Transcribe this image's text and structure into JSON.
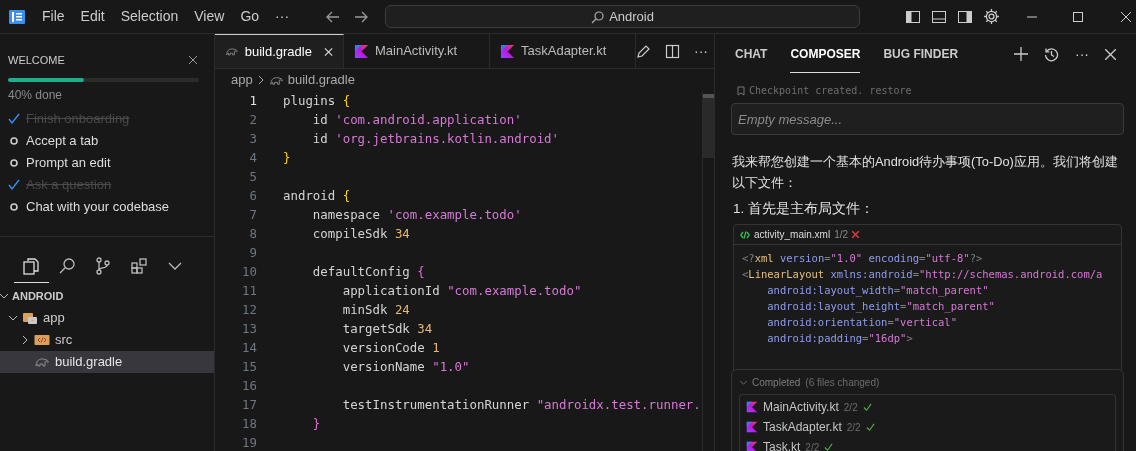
{
  "menu": [
    "File",
    "Edit",
    "Selection",
    "View",
    "Go",
    "···"
  ],
  "search": {
    "value": "Android"
  },
  "welcome": {
    "title": "WELCOME",
    "level": 0.4,
    "progress_text": "40% done",
    "items": [
      {
        "label": "Finish onboarding",
        "done": true
      },
      {
        "label": "Accept a tab",
        "done": false
      },
      {
        "label": "Prompt an edit",
        "done": false
      },
      {
        "label": "Ask a question",
        "done": true
      },
      {
        "label": "Chat with your codebase",
        "done": false
      }
    ]
  },
  "explorer": {
    "root": "ANDROID",
    "tree": [
      {
        "label": "app",
        "kind": "module",
        "expanded": true,
        "selected": false,
        "children": [
          {
            "label": "src",
            "kind": "folder",
            "expanded": false,
            "selected": false
          },
          {
            "label": "build.gradle",
            "kind": "gradle",
            "selected": true
          }
        ]
      }
    ]
  },
  "editor_tabs": [
    {
      "label": "build.gradle",
      "kind": "gradle",
      "selected": true
    },
    {
      "label": "MainActivity.kt",
      "kind": "kotlin",
      "selected": false
    },
    {
      "label": "TaskAdapter.kt",
      "kind": "kotlin",
      "selected": false
    }
  ],
  "breadcrumb": [
    "app",
    "build.gradle"
  ],
  "code": [
    {
      "number": "1",
      "current": true,
      "tokens": [
        {
          "kind": "plain",
          "text": "plugins "
        },
        {
          "kind": "brace1",
          "text": "{"
        }
      ]
    },
    {
      "number": "2",
      "current": false,
      "tokens": [
        {
          "kind": "plain",
          "text": "    id "
        },
        {
          "kind": "string",
          "text": "'com.android.application'"
        }
      ]
    },
    {
      "number": "3",
      "current": false,
      "tokens": [
        {
          "kind": "plain",
          "text": "    id "
        },
        {
          "kind": "string",
          "text": "'org.jetbrains.kotlin.android'"
        }
      ]
    },
    {
      "number": "4",
      "current": false,
      "tokens": [
        {
          "kind": "brace1",
          "text": "}"
        }
      ]
    },
    {
      "number": "5",
      "current": false
    },
    {
      "number": "6",
      "current": false,
      "tokens": [
        {
          "kind": "plain",
          "text": "android "
        },
        {
          "kind": "brace1",
          "text": "{"
        }
      ]
    },
    {
      "number": "7",
      "current": false,
      "tokens": [
        {
          "kind": "plain",
          "text": "    namespace "
        },
        {
          "kind": "string",
          "text": "'com.example.todo'"
        }
      ]
    },
    {
      "number": "8",
      "current": false,
      "tokens": [
        {
          "kind": "plain",
          "text": "    compileSdk "
        },
        {
          "kind": "number",
          "text": "34"
        }
      ]
    },
    {
      "number": "9",
      "current": false
    },
    {
      "number": "10",
      "current": false,
      "tokens": [
        {
          "kind": "plain",
          "text": "    defaultConfig "
        },
        {
          "kind": "brace2",
          "text": "{"
        }
      ]
    },
    {
      "number": "11",
      "current": false,
      "tokens": [
        {
          "kind": "plain",
          "text": "        applicationId "
        },
        {
          "kind": "string",
          "text": "\"com.example.todo\""
        }
      ]
    },
    {
      "number": "12",
      "current": false,
      "tokens": [
        {
          "kind": "plain",
          "text": "        minSdk "
        },
        {
          "kind": "number",
          "text": "24"
        }
      ]
    },
    {
      "number": "13",
      "current": false,
      "tokens": [
        {
          "kind": "plain",
          "text": "        targetSdk "
        },
        {
          "kind": "number",
          "text": "34"
        }
      ]
    },
    {
      "number": "14",
      "current": false,
      "tokens": [
        {
          "kind": "plain",
          "text": "        versionCode "
        },
        {
          "kind": "number",
          "text": "1"
        }
      ]
    },
    {
      "number": "15",
      "current": false,
      "tokens": [
        {
          "kind": "plain",
          "text": "        versionName "
        },
        {
          "kind": "string",
          "text": "\"1.0\""
        }
      ]
    },
    {
      "number": "16",
      "current": false
    },
    {
      "number": "17",
      "current": false,
      "tokens": [
        {
          "kind": "plain",
          "text": "        testInstrumentationRunner "
        },
        {
          "kind": "string",
          "text": "\"androidx.test.runner."
        }
      ]
    },
    {
      "number": "18",
      "current": false,
      "tokens": [
        {
          "kind": "brace2",
          "text": "    }"
        }
      ]
    },
    {
      "number": "19",
      "current": false
    }
  ],
  "composer": {
    "tabs": [
      {
        "label": "CHAT",
        "selected": false
      },
      {
        "label": "COMPOSER",
        "selected": true
      },
      {
        "label": "BUG FINDER",
        "selected": false
      }
    ],
    "checkpoint": "Checkpoint created. restore",
    "input": {
      "placeholder": "Empty message..."
    },
    "message": "我来帮您创建一个基本的Android待办事项(To-Do)应用。我们将创建以下文件：",
    "step": "1. 首先是主布局文件：",
    "file_card": {
      "name": "activity_main.xml",
      "count": "1/2",
      "code": [
        {
          "tokens": [
            {
              "kind": "punct",
              "text": "<?"
            },
            {
              "kind": "tag",
              "text": "xml"
            },
            {
              "kind": "attr",
              "text": " version"
            },
            {
              "kind": "punct",
              "text": "="
            },
            {
              "kind": "string",
              "text": "\"1.0\""
            },
            {
              "kind": "attr",
              "text": " encoding"
            },
            {
              "kind": "punct",
              "text": "="
            },
            {
              "kind": "string",
              "text": "\"utf-8\""
            },
            {
              "kind": "punct",
              "text": "?>"
            }
          ]
        },
        {
          "tokens": [
            {
              "kind": "punct",
              "text": "<"
            },
            {
              "kind": "tag",
              "text": "LinearLayout"
            },
            {
              "kind": "attr",
              "text": " xmlns:android"
            },
            {
              "kind": "punct",
              "text": "="
            },
            {
              "kind": "string",
              "text": "\"http://schemas.android.com/a"
            }
          ]
        },
        {
          "tokens": [
            {
              "kind": "attr",
              "text": "    android:layout_width"
            },
            {
              "kind": "punct",
              "text": "="
            },
            {
              "kind": "string",
              "text": "\"match_parent\""
            }
          ]
        },
        {
          "tokens": [
            {
              "kind": "attr",
              "text": "    android:layout_height"
            },
            {
              "kind": "punct",
              "text": "="
            },
            {
              "kind": "string",
              "text": "\"match_parent\""
            }
          ]
        },
        {
          "tokens": [
            {
              "kind": "attr",
              "text": "    android:orientation"
            },
            {
              "kind": "punct",
              "text": "="
            },
            {
              "kind": "string",
              "text": "\"vertical\""
            }
          ]
        },
        {
          "tokens": [
            {
              "kind": "attr",
              "text": "    android:padding"
            },
            {
              "kind": "punct",
              "text": "="
            },
            {
              "kind": "string",
              "text": "\"16dp\""
            },
            {
              "kind": "punct",
              "text": ">"
            }
          ]
        }
      ]
    },
    "completed": {
      "title": "Completed",
      "detail": "(6 files changed)",
      "files": [
        {
          "name": "MainActivity.kt",
          "count": "2/2"
        },
        {
          "name": "TaskAdapter.kt",
          "count": "2/2"
        },
        {
          "name": "Task.kt",
          "count": "2/2"
        }
      ]
    }
  }
}
